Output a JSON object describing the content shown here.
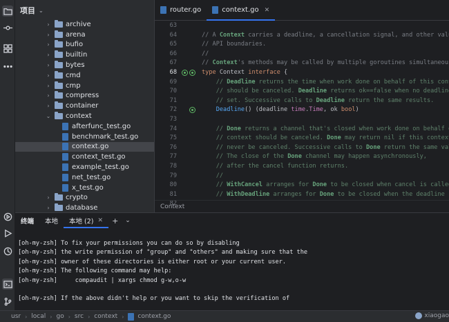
{
  "project": {
    "header_title": "项目",
    "tree": [
      {
        "type": "folder",
        "level": 1,
        "label": "archive",
        "expanded": false
      },
      {
        "type": "folder",
        "level": 1,
        "label": "arena",
        "expanded": false
      },
      {
        "type": "folder",
        "level": 1,
        "label": "bufio",
        "expanded": false
      },
      {
        "type": "folder",
        "level": 1,
        "label": "builtin",
        "expanded": false
      },
      {
        "type": "folder",
        "level": 1,
        "label": "bytes",
        "expanded": false
      },
      {
        "type": "folder",
        "level": 1,
        "label": "cmd",
        "expanded": false
      },
      {
        "type": "folder",
        "level": 1,
        "label": "cmp",
        "expanded": false
      },
      {
        "type": "folder",
        "level": 1,
        "label": "compress",
        "expanded": false
      },
      {
        "type": "folder",
        "level": 1,
        "label": "container",
        "expanded": false
      },
      {
        "type": "folder",
        "level": 1,
        "label": "context",
        "expanded": true
      },
      {
        "type": "file",
        "level": 2,
        "label": "afterfunc_test.go"
      },
      {
        "type": "file",
        "level": 2,
        "label": "benchmark_test.go"
      },
      {
        "type": "file",
        "level": 2,
        "label": "context.go",
        "selected": true
      },
      {
        "type": "file",
        "level": 2,
        "label": "context_test.go"
      },
      {
        "type": "file",
        "level": 2,
        "label": "example_test.go"
      },
      {
        "type": "file",
        "level": 2,
        "label": "net_test.go"
      },
      {
        "type": "file",
        "level": 2,
        "label": "x_test.go"
      },
      {
        "type": "folder",
        "level": 1,
        "label": "crypto",
        "expanded": false
      },
      {
        "type": "folder",
        "level": 1,
        "label": "database",
        "expanded": false
      }
    ]
  },
  "editor": {
    "tabs": [
      {
        "label": "router.go",
        "active": false
      },
      {
        "label": "context.go",
        "active": true
      }
    ],
    "line_numbers": [
      "63",
      "64",
      "65",
      "66",
      "67",
      "68",
      "69",
      "70",
      "71",
      "72",
      "73",
      "74",
      "75",
      "76",
      "77",
      "78",
      "79",
      "80",
      "81",
      "82"
    ],
    "breadcrumb": "Context"
  },
  "terminal": {
    "title": "终端",
    "tabs": [
      {
        "label": "本地",
        "active": false
      },
      {
        "label": "本地 (2)",
        "active": true
      }
    ],
    "lines": [
      "[oh-my-zsh] To fix your permissions you can do so by disabling",
      "[oh-my-zsh] the write permission of \"group\" and \"others\" and making sure that the",
      "[oh-my-zsh] owner of these directories is either root or your current user.",
      "[oh-my-zsh] The following command may help:",
      "[oh-my-zsh]     compaudit | xargs chmod g-w,o-w",
      "",
      "[oh-my-zsh] If the above didn't help or you want to skip the verification of"
    ]
  },
  "statusbar": {
    "path": [
      "usr",
      "local",
      "go",
      "src",
      "context",
      "context.go"
    ],
    "user": "xiaogao"
  },
  "icons": {
    "activity": [
      "folder-icon",
      "commit-icon",
      "structure-icon",
      "more-icon",
      "run-icon",
      "play-icon",
      "services-icon",
      "terminal-icon",
      "git-icon"
    ]
  }
}
